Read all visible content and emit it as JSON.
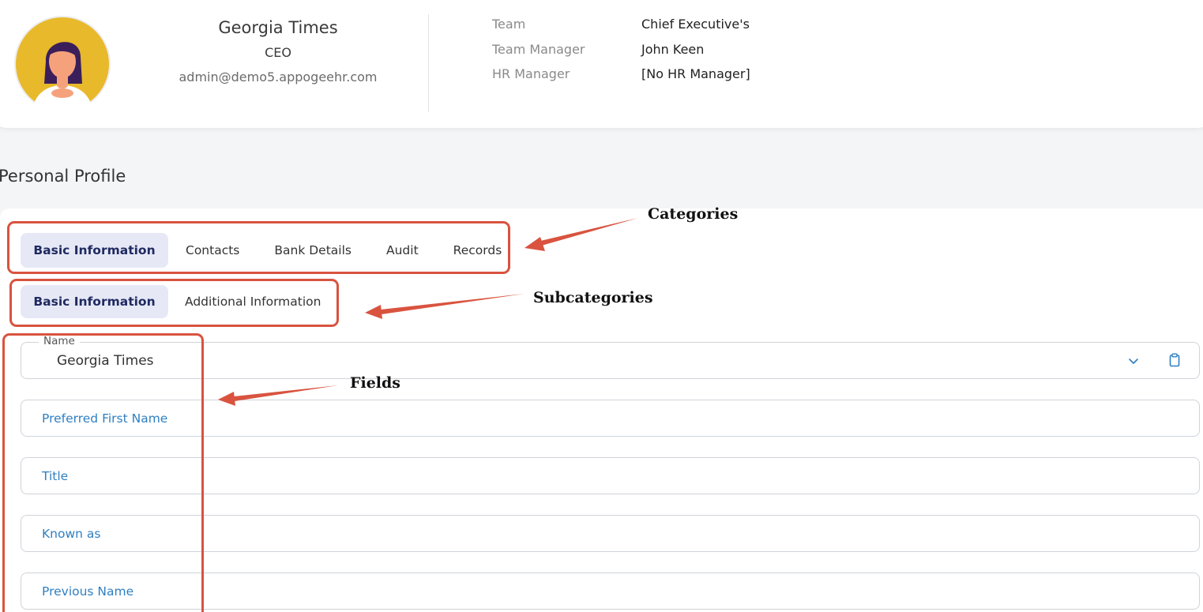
{
  "profile": {
    "name": "Georgia Times",
    "role": "CEO",
    "email": "admin@demo5.appogeehr.com",
    "avatar_icon": "user-avatar-icon"
  },
  "org": {
    "team_label": "Team",
    "team_value": "Chief Executive's",
    "manager_label": "Team Manager",
    "manager_value": "John Keen",
    "hr_label": "HR Manager",
    "hr_value": "[No HR Manager]"
  },
  "section_title": "Personal Profile",
  "categories": [
    {
      "label": "Basic Information",
      "active": true
    },
    {
      "label": "Contacts",
      "active": false
    },
    {
      "label": "Bank Details",
      "active": false
    },
    {
      "label": "Audit",
      "active": false
    },
    {
      "label": "Records",
      "active": false
    }
  ],
  "subcategories": [
    {
      "label": "Basic Information",
      "active": true
    },
    {
      "label": "Additional Information",
      "active": false
    }
  ],
  "fields": {
    "name": {
      "label": "Name",
      "value": "Georgia Times"
    },
    "preferred_first_name": {
      "placeholder": "Preferred First Name"
    },
    "title": {
      "placeholder": "Title"
    },
    "known_as": {
      "placeholder": "Known as"
    },
    "previous_name": {
      "placeholder": "Previous Name"
    }
  },
  "annotations": {
    "categories": "Categories",
    "subcategories": "Subcategories",
    "fields": "Fields",
    "color": "#d9533f"
  },
  "colors": {
    "accent": "#2f7fc1",
    "active_tab_bg": "#e6e8f6",
    "active_tab_text": "#1f2a60",
    "avatar_bg": "#e8b92a"
  }
}
